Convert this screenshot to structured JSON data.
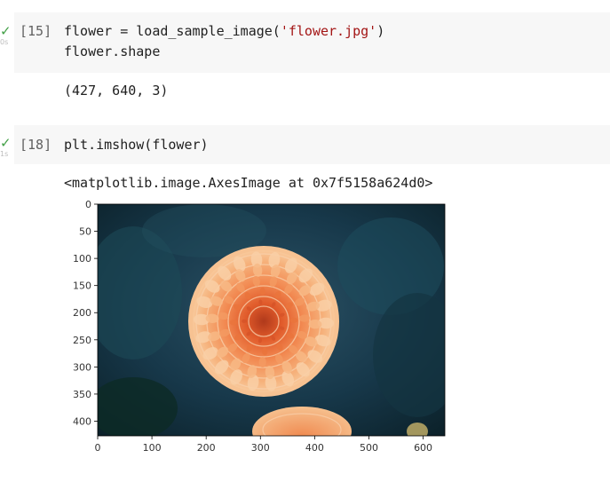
{
  "cells": [
    {
      "prompt": "[15]",
      "runtime": "0s",
      "code_line1_a": "flower = load_sample_image(",
      "code_line1_str": "'flower.jpg'",
      "code_line1_b": ")",
      "code_line2": "flower.shape",
      "output": "(427, 640, 3)"
    },
    {
      "prompt": "[18]",
      "runtime": "1s",
      "code_line1": "plt.imshow(flower)",
      "output": "<matplotlib.image.AxesImage at 0x7f5158a624d0>"
    }
  ],
  "plot": {
    "yticks": [
      "0",
      "50",
      "100",
      "150",
      "200",
      "250",
      "300",
      "350",
      "400"
    ],
    "xticks": [
      "0",
      "100",
      "200",
      "300",
      "400",
      "500",
      "600"
    ]
  },
  "colors": {
    "success": "#43a047",
    "string": "#a31515",
    "cell_bg": "#f7f7f7"
  },
  "icons": {
    "status": "check-icon"
  }
}
